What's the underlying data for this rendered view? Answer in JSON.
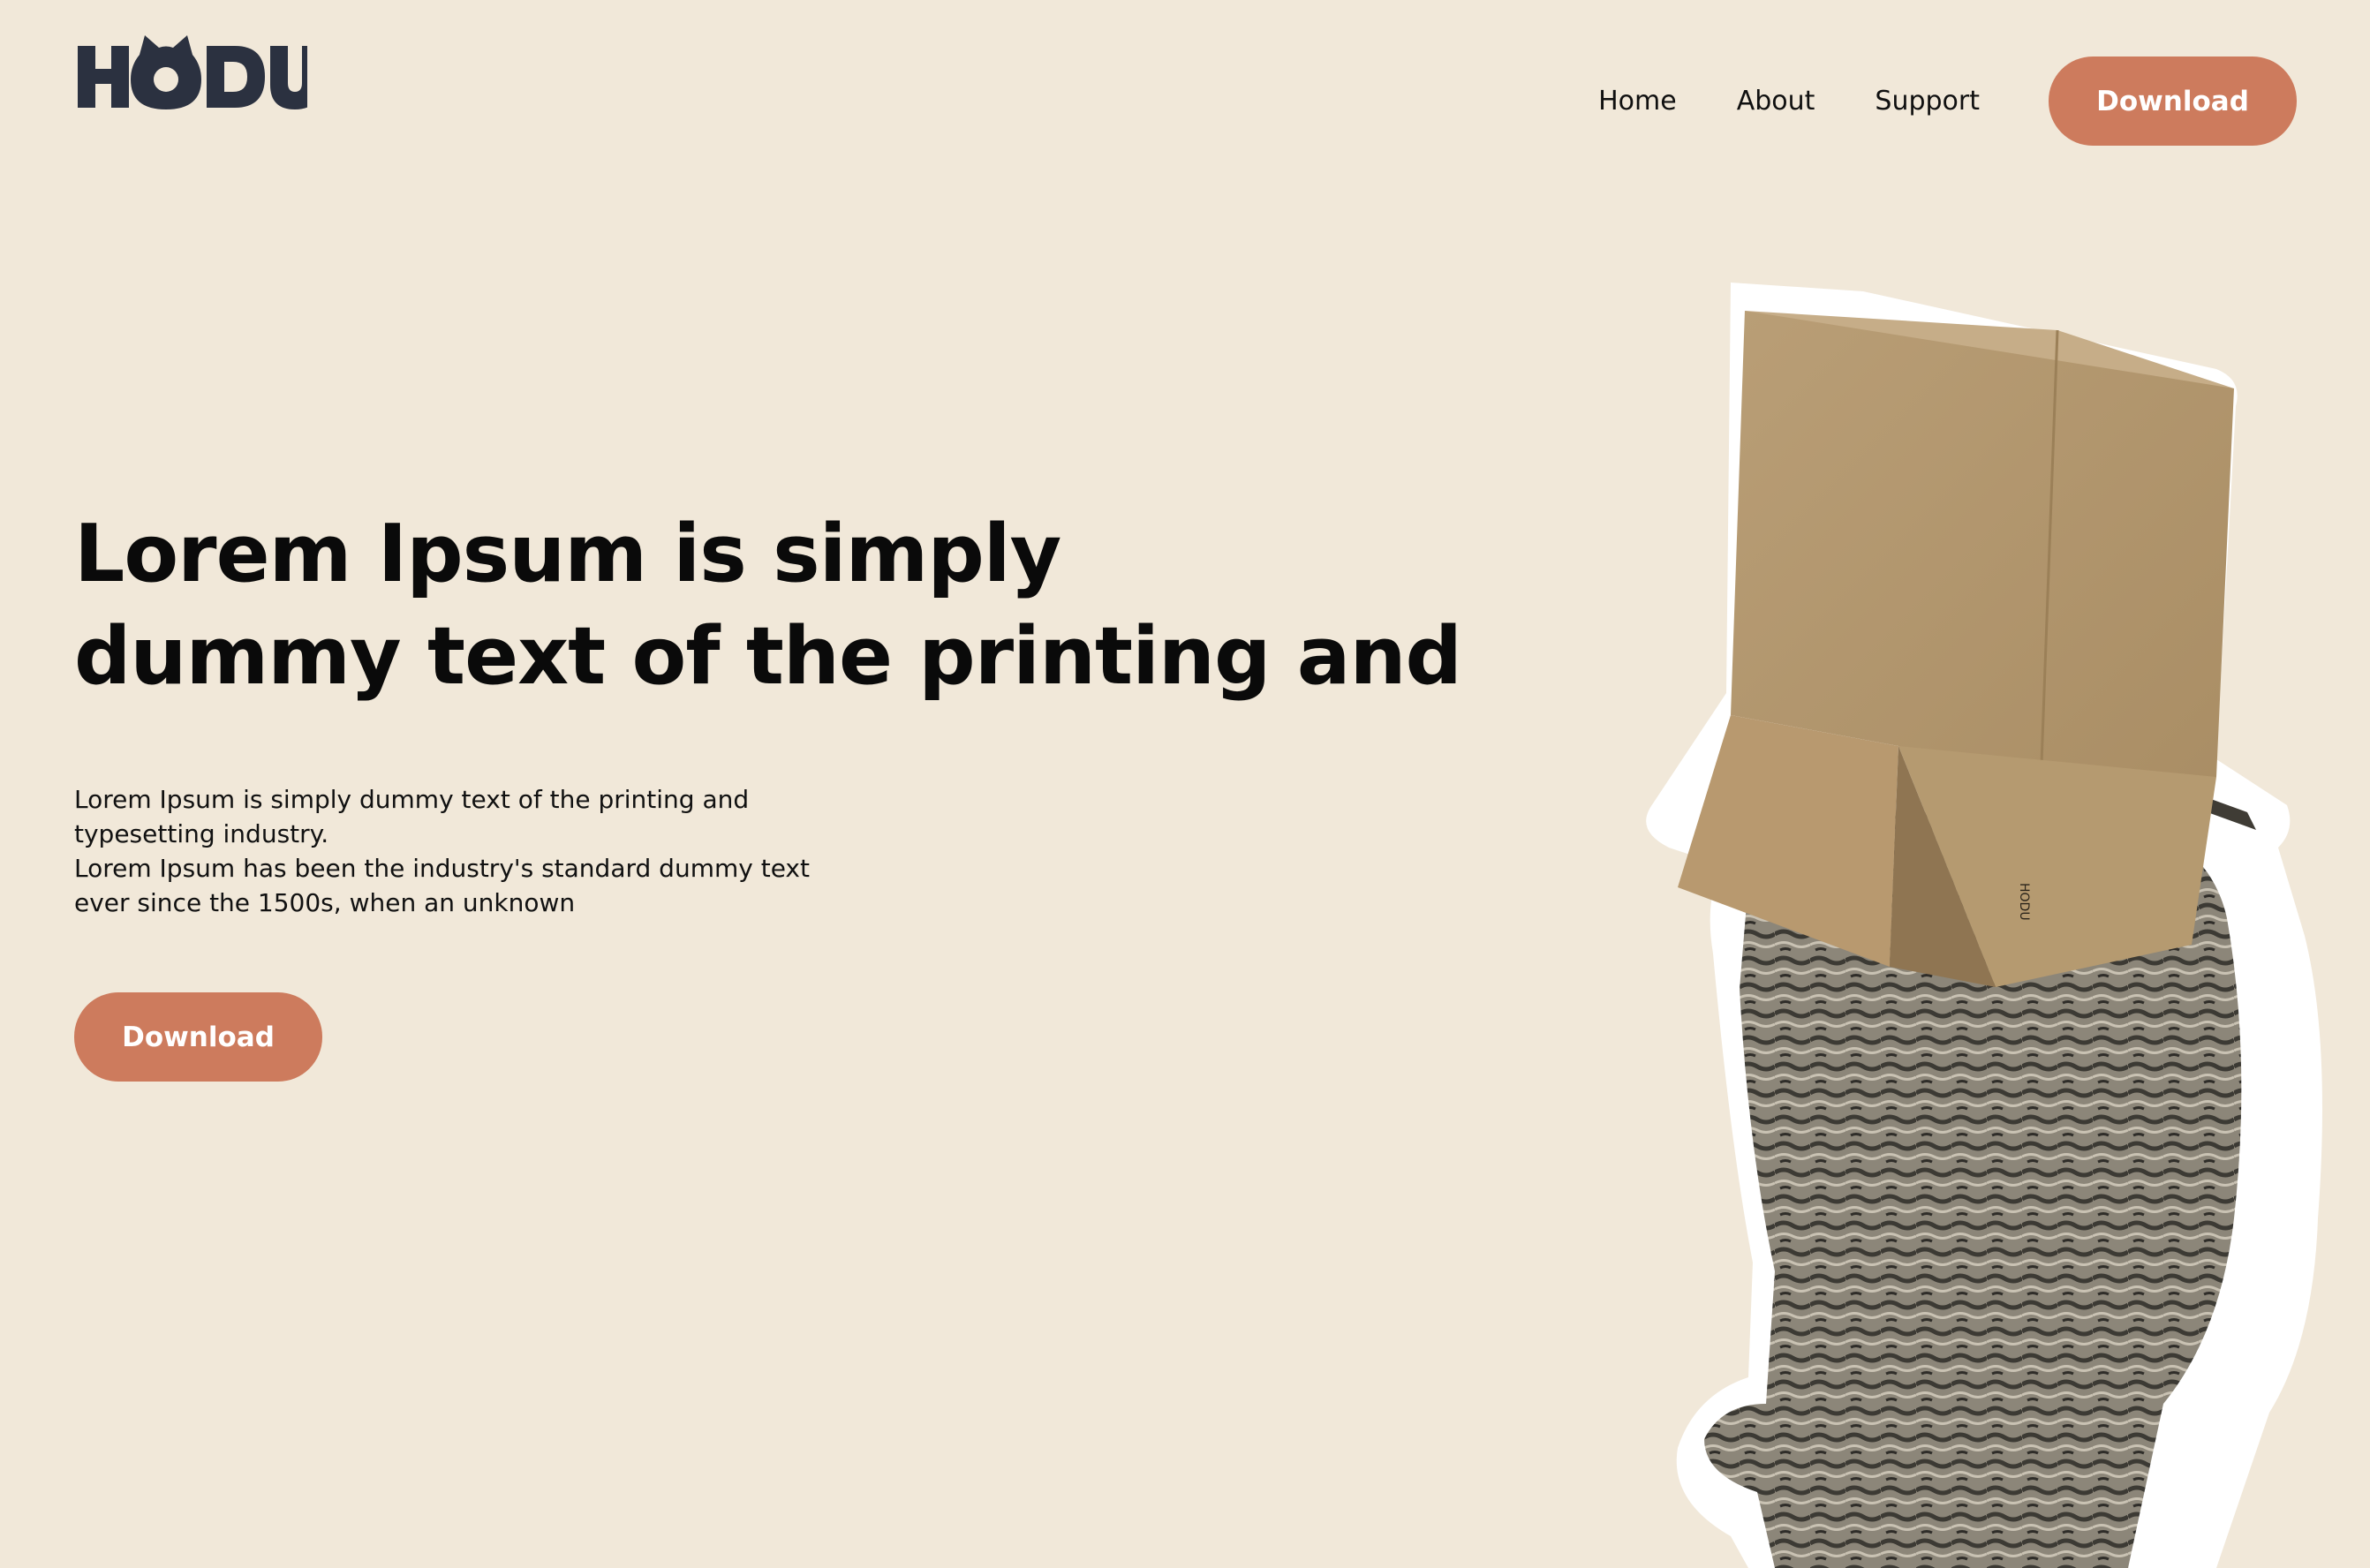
{
  "brand": {
    "logo_text": "HODU",
    "logo_color": "#2b3140"
  },
  "nav": {
    "items": [
      {
        "label": "Home"
      },
      {
        "label": "About"
      },
      {
        "label": "Support"
      }
    ],
    "download_label": "Download"
  },
  "hero": {
    "title_lines": [
      "Lorem Ipsum is simply",
      "dummy text of the printing and"
    ],
    "body_lines": [
      "Lorem Ipsum is simply dummy text of the printing and",
      "typesetting industry.",
      "Lorem Ipsum has been the industry's standard dummy text",
      "ever since the 1500s, when an unknown"
    ],
    "download_label": "Download"
  },
  "illustration": {
    "subject": "cat-with-cardboard-box-on-head",
    "box_print": "HODU"
  },
  "colors": {
    "background": "#f1e8d9",
    "accent": "#cd7b5d",
    "text": "#0c0c0c",
    "box": "#b89c73",
    "cat_fur": "#8a8479"
  }
}
